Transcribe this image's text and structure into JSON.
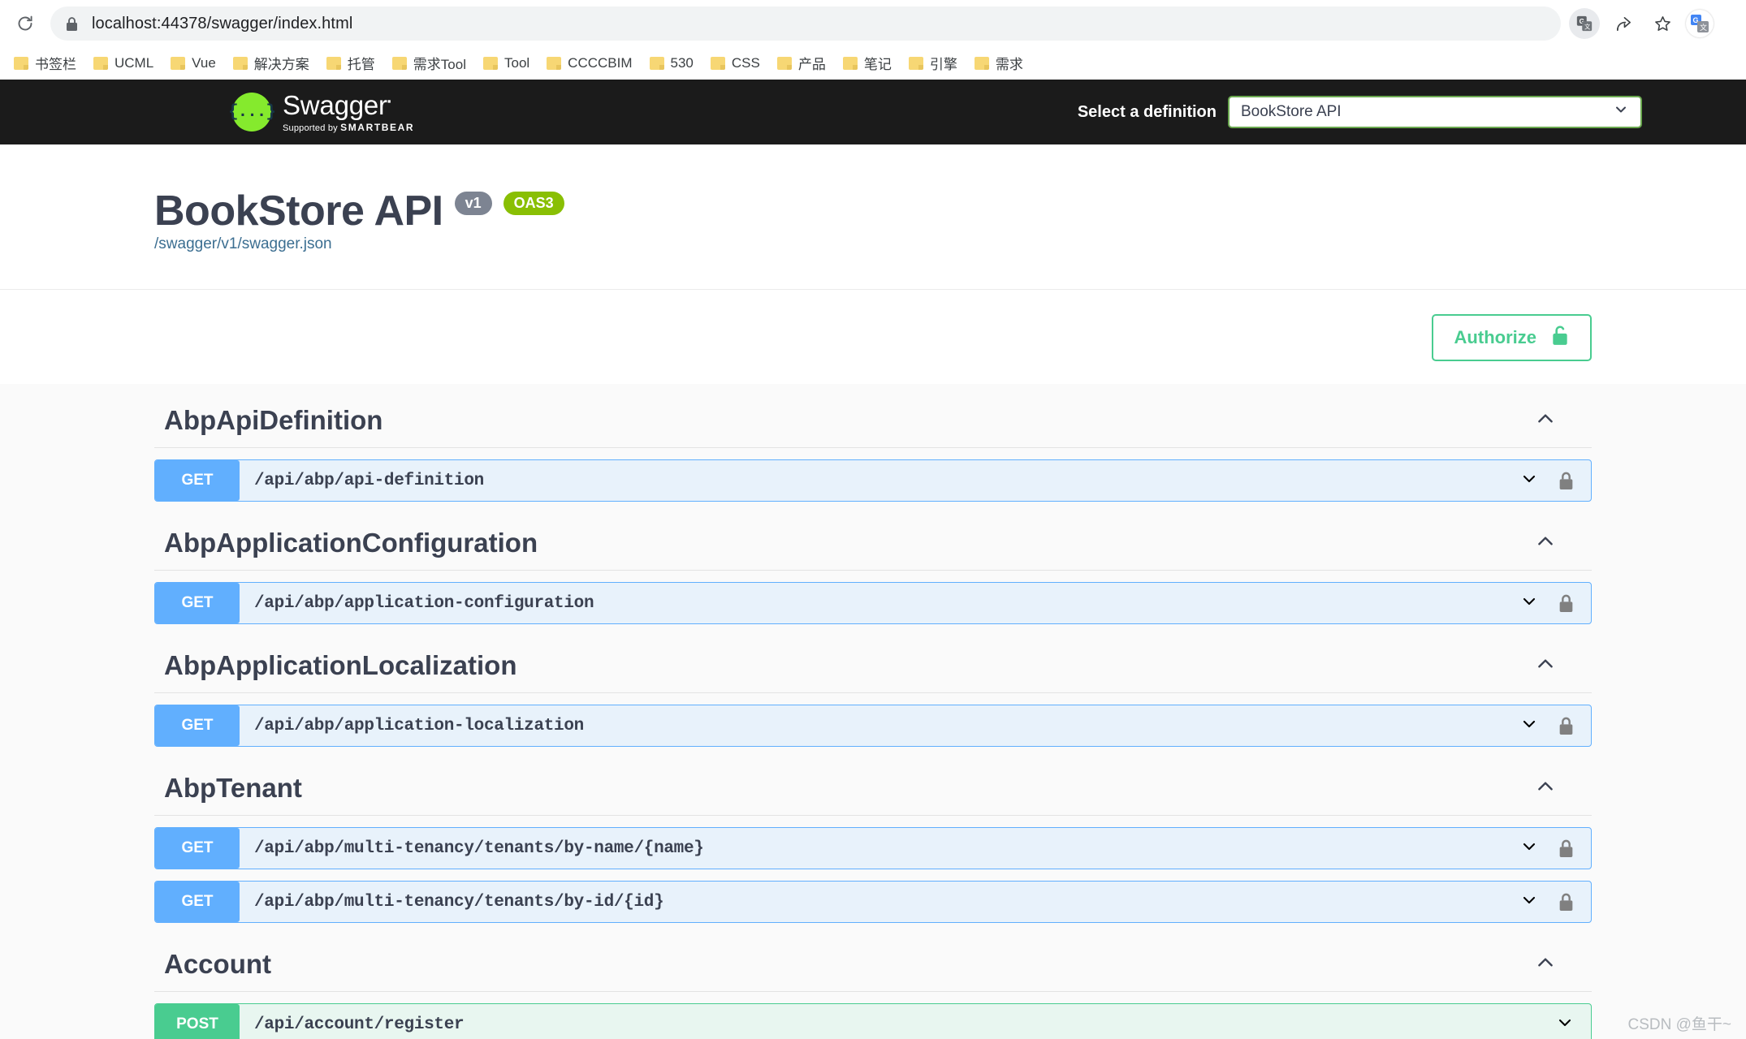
{
  "browser": {
    "reload_icon": "reload-icon",
    "site_lock_icon": "lock-icon",
    "url_scheme_host": "localhost:44378",
    "url_path": "/swagger/index.html",
    "url_full": "localhost:44378/swagger/index.html",
    "toolbar_icons": [
      {
        "name": "translate-icon",
        "glyph": "translate"
      },
      {
        "name": "share-icon",
        "glyph": "share"
      },
      {
        "name": "bookmark-star-icon",
        "glyph": "star"
      },
      {
        "name": "google-translate-extension-icon",
        "glyph": "gtranslate"
      }
    ],
    "bookmarks": [
      {
        "label": "书签栏"
      },
      {
        "label": "UCML"
      },
      {
        "label": "Vue"
      },
      {
        "label": "解决方案"
      },
      {
        "label": "托管"
      },
      {
        "label": "需求Tool"
      },
      {
        "label": "Tool"
      },
      {
        "label": "CCCCBIM"
      },
      {
        "label": "530"
      },
      {
        "label": "CSS"
      },
      {
        "label": "产品"
      },
      {
        "label": "笔记"
      },
      {
        "label": "引擎"
      },
      {
        "label": "需求"
      }
    ]
  },
  "topbar": {
    "logo_mark": "{...}",
    "logo_name": "Swagger",
    "logo_tm": "™",
    "logo_supported_prefix": "Supported by",
    "logo_supported_brand": "SMARTBEAR",
    "definition_label": "Select a definition",
    "definition_selected": "BookStore API",
    "definition_options": [
      "BookStore API"
    ],
    "background_color": "#1b1b1b",
    "accent_green": "#85ea2d"
  },
  "info": {
    "title": "BookStore API",
    "version_badge": "v1",
    "spec_badge": "OAS3",
    "spec_url": "/swagger/v1/swagger.json"
  },
  "auth": {
    "authorize_label": "Authorize",
    "lock_icon": "unlock-icon",
    "accent_color": "#49cc90"
  },
  "colors": {
    "get": "#61affe",
    "post": "#49cc90",
    "get_bg": "#e8f2fb",
    "post_bg": "#e8f6f0",
    "title_text": "#3b4151",
    "link": "#3b6e91",
    "badge_version": "#7d8492",
    "badge_oas": "#89bf04"
  },
  "tags": [
    {
      "name": "AbpApiDefinition",
      "expanded": true,
      "collapse_icon": "chevron-up-icon",
      "operations": [
        {
          "method": "GET",
          "path": "/api/abp/api-definition",
          "locked": true,
          "expand_icon": "chevron-down-icon",
          "lock_icon": "lock-closed-icon"
        }
      ]
    },
    {
      "name": "AbpApplicationConfiguration",
      "expanded": true,
      "collapse_icon": "chevron-up-icon",
      "operations": [
        {
          "method": "GET",
          "path": "/api/abp/application-configuration",
          "locked": true,
          "expand_icon": "chevron-down-icon",
          "lock_icon": "lock-closed-icon"
        }
      ]
    },
    {
      "name": "AbpApplicationLocalization",
      "expanded": true,
      "collapse_icon": "chevron-up-icon",
      "operations": [
        {
          "method": "GET",
          "path": "/api/abp/application-localization",
          "locked": true,
          "expand_icon": "chevron-down-icon",
          "lock_icon": "lock-closed-icon"
        }
      ]
    },
    {
      "name": "AbpTenant",
      "expanded": true,
      "collapse_icon": "chevron-up-icon",
      "operations": [
        {
          "method": "GET",
          "path": "/api/abp/multi-tenancy/tenants/by-name/{name}",
          "locked": true,
          "expand_icon": "chevron-down-icon",
          "lock_icon": "lock-closed-icon"
        },
        {
          "method": "GET",
          "path": "/api/abp/multi-tenancy/tenants/by-id/{id}",
          "locked": true,
          "expand_icon": "chevron-down-icon",
          "lock_icon": "lock-closed-icon"
        }
      ]
    },
    {
      "name": "Account",
      "expanded": true,
      "collapse_icon": "chevron-up-icon",
      "operations": [
        {
          "method": "POST",
          "path": "/api/account/register",
          "locked": false,
          "expand_icon": "chevron-down-icon",
          "lock_icon": ""
        }
      ]
    }
  ],
  "watermark": "CSDN @鱼干~"
}
